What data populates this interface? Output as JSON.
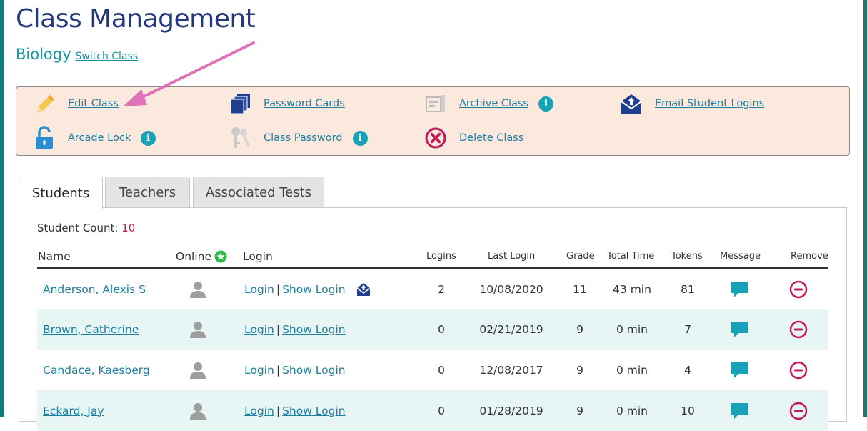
{
  "page": {
    "title": "Class Management",
    "class_name": "Biology",
    "switch_class": "Switch Class"
  },
  "actions": {
    "edit_class": "Edit Class",
    "password_cards": "Password Cards",
    "archive_class": "Archive Class",
    "email_student_logins": "Email Student Logins",
    "arcade_lock": "Arcade Lock",
    "class_password": "Class Password",
    "delete_class": "Delete Class"
  },
  "tabs": [
    {
      "label": "Students",
      "active": true
    },
    {
      "label": "Teachers",
      "active": false
    },
    {
      "label": "Associated Tests",
      "active": false
    }
  ],
  "students": {
    "count_label": "Student Count:",
    "count": "10",
    "columns": {
      "name": "Name",
      "online": "Online",
      "login": "Login",
      "logins": "Logins",
      "last_login": "Last Login",
      "grade": "Grade",
      "total_time": "Total Time",
      "tokens": "Tokens",
      "message": "Message",
      "remove": "Remove"
    },
    "login_link": "Login",
    "show_login_link": "Show Login",
    "rows": [
      {
        "name": "Anderson, Alexis S",
        "logins": "2",
        "last_login": "10/08/2020",
        "grade": "11",
        "total_time": "43 min",
        "tokens": "81"
      },
      {
        "name": "Brown, Catherine",
        "logins": "0",
        "last_login": "02/21/2019",
        "grade": "9",
        "total_time": "0 min",
        "tokens": "7"
      },
      {
        "name": "Candace, Kaesberg",
        "logins": "0",
        "last_login": "12/08/2017",
        "grade": "9",
        "total_time": "0 min",
        "tokens": "4"
      },
      {
        "name": "Eckard, Jay",
        "logins": "0",
        "last_login": "01/28/2019",
        "grade": "9",
        "total_time": "0 min",
        "tokens": "10"
      }
    ]
  },
  "colors": {
    "title": "#24397d",
    "accent_teal": "#17a2b8",
    "link": "#1f7fa0",
    "remove": "#c0185a",
    "action_box_bg": "#fbe9de",
    "annotation_arrow": "#e072b8"
  }
}
